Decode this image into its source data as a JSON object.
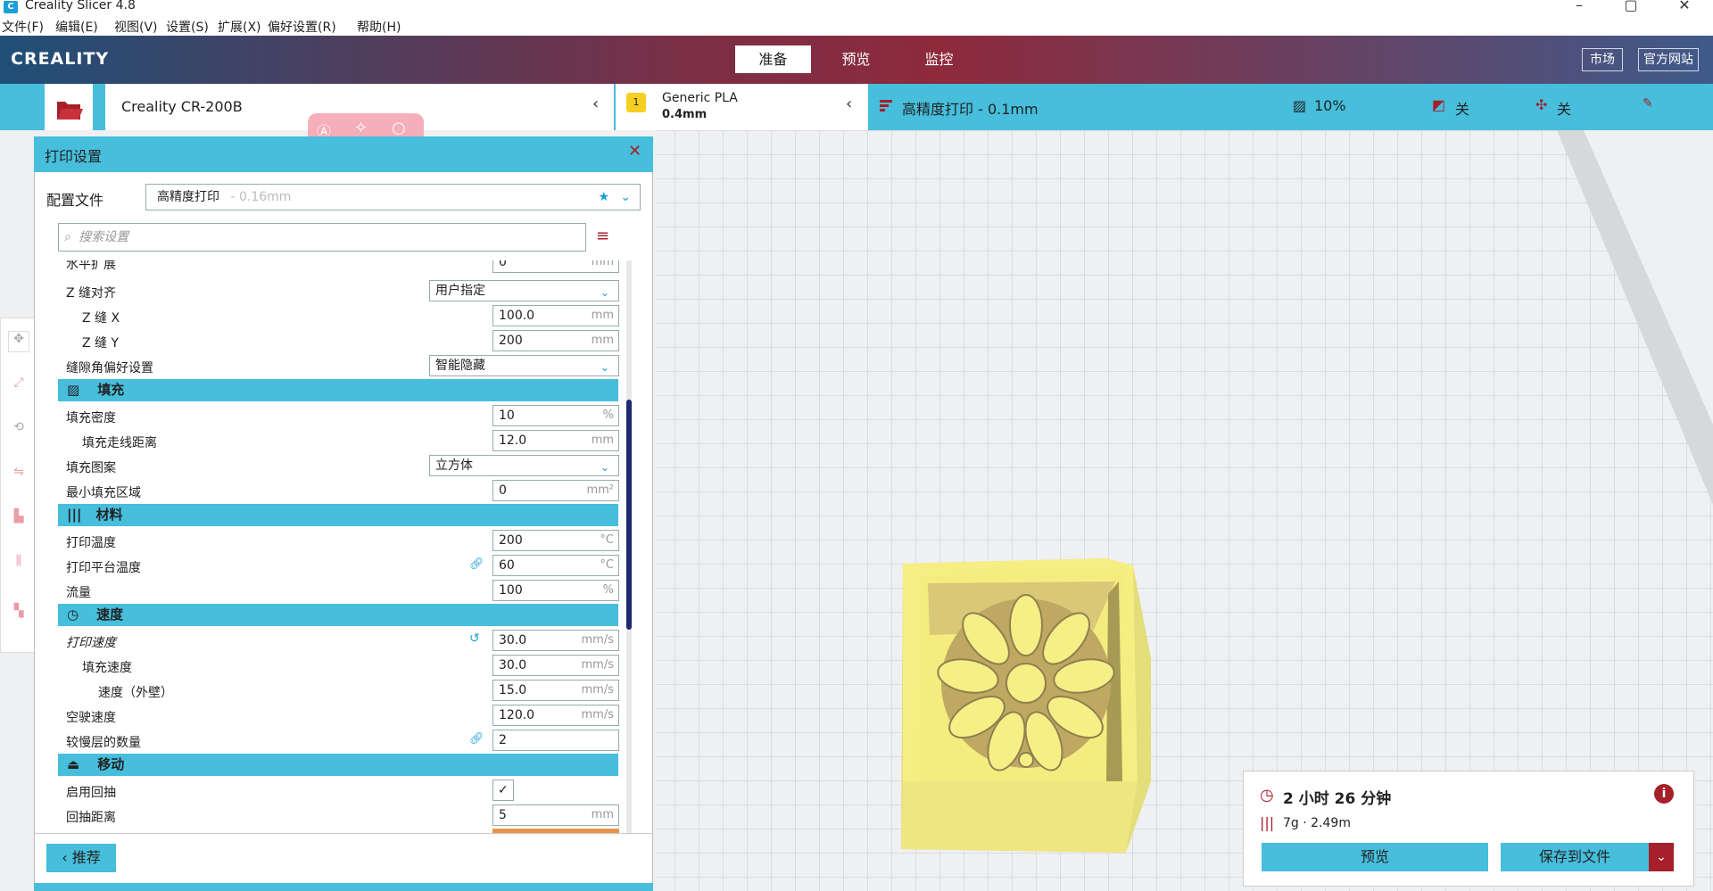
{
  "window": {
    "title": "Creality Slicer 4.8",
    "minimize": "–",
    "maximize": "▢",
    "close": "✕"
  },
  "menu": [
    "文件(F)",
    "编辑(E)",
    "视图(V)",
    "设置(S)",
    "扩展(X)",
    "偏好设置(R)",
    "帮助(H)"
  ],
  "header": {
    "logo": "CREALITY",
    "tabs": {
      "prepare": "准备",
      "preview": "预览",
      "monitor": "监控"
    },
    "market": "市场",
    "website": "官方网站"
  },
  "toolbar": {
    "printer": "Creality CR-200B",
    "material_name": "Generic PLA",
    "nozzle": "0.4mm",
    "extruder_number": "1",
    "profile": "高精度打印 - 0.1mm",
    "infill": "10%",
    "support": "关",
    "adhesion": "关"
  },
  "panel": {
    "title": "打印设置",
    "profile_label": "配置文件",
    "profile_value": "高精度打印",
    "profile_suffix": "- 0.16mm",
    "search_placeholder": "搜索设置",
    "recommend": "推荐",
    "rows": [
      {
        "label": "水平扩展",
        "value": "0",
        "unit": "mm",
        "indent": 0,
        "type": "field"
      },
      {
        "label": "Z 缝对齐",
        "value": "用户指定",
        "unit": "",
        "indent": 0,
        "type": "select"
      },
      {
        "label": "Z 缝 X",
        "value": "100.0",
        "unit": "mm",
        "indent": 1,
        "type": "field"
      },
      {
        "label": "Z 缝 Y",
        "value": "200",
        "unit": "mm",
        "indent": 1,
        "type": "field"
      },
      {
        "label": "缝隙角偏好设置",
        "value": "智能隐藏",
        "unit": "",
        "indent": 0,
        "type": "select"
      }
    ],
    "sections": {
      "infill": "填充",
      "material": "材料",
      "speed": "速度",
      "travel": "移动"
    },
    "infill_rows": [
      {
        "label": "填充密度",
        "value": "10",
        "unit": "%"
      },
      {
        "label": "填充走线距离",
        "value": "12.0",
        "unit": "mm"
      },
      {
        "label": "填充图案",
        "value": "立方体",
        "unit": ""
      },
      {
        "label": "最小填充区域",
        "value": "0",
        "unit": "mm²"
      }
    ],
    "material_rows": [
      {
        "label": "打印温度",
        "value": "200",
        "unit": "°C"
      },
      {
        "label": "打印平台温度",
        "value": "60",
        "unit": "°C"
      },
      {
        "label": "流量",
        "value": "100",
        "unit": "%"
      }
    ],
    "speed_rows": [
      {
        "label": "打印速度",
        "value": "30.0",
        "unit": "mm/s"
      },
      {
        "label": "填充速度",
        "value": "30.0",
        "unit": "mm/s"
      },
      {
        "label": "速度（外壁）",
        "value": "15.0",
        "unit": "mm/s"
      },
      {
        "label": "空驶速度",
        "value": "120.0",
        "unit": "mm/s"
      },
      {
        "label": "较慢层的数量",
        "value": "2",
        "unit": ""
      }
    ],
    "travel_rows": [
      {
        "label": "启用回抽",
        "value": "✓",
        "unit": ""
      },
      {
        "label": "回抽距离",
        "value": "5",
        "unit": "mm"
      }
    ]
  },
  "estimate": {
    "time": "2 小时 26 分钟",
    "material": "7g · 2.49m",
    "preview_btn": "预览",
    "save_btn": "保存到文件"
  },
  "colors": {
    "accent": "#46bedc",
    "model": "#f6ee82",
    "danger": "#a5202a"
  }
}
